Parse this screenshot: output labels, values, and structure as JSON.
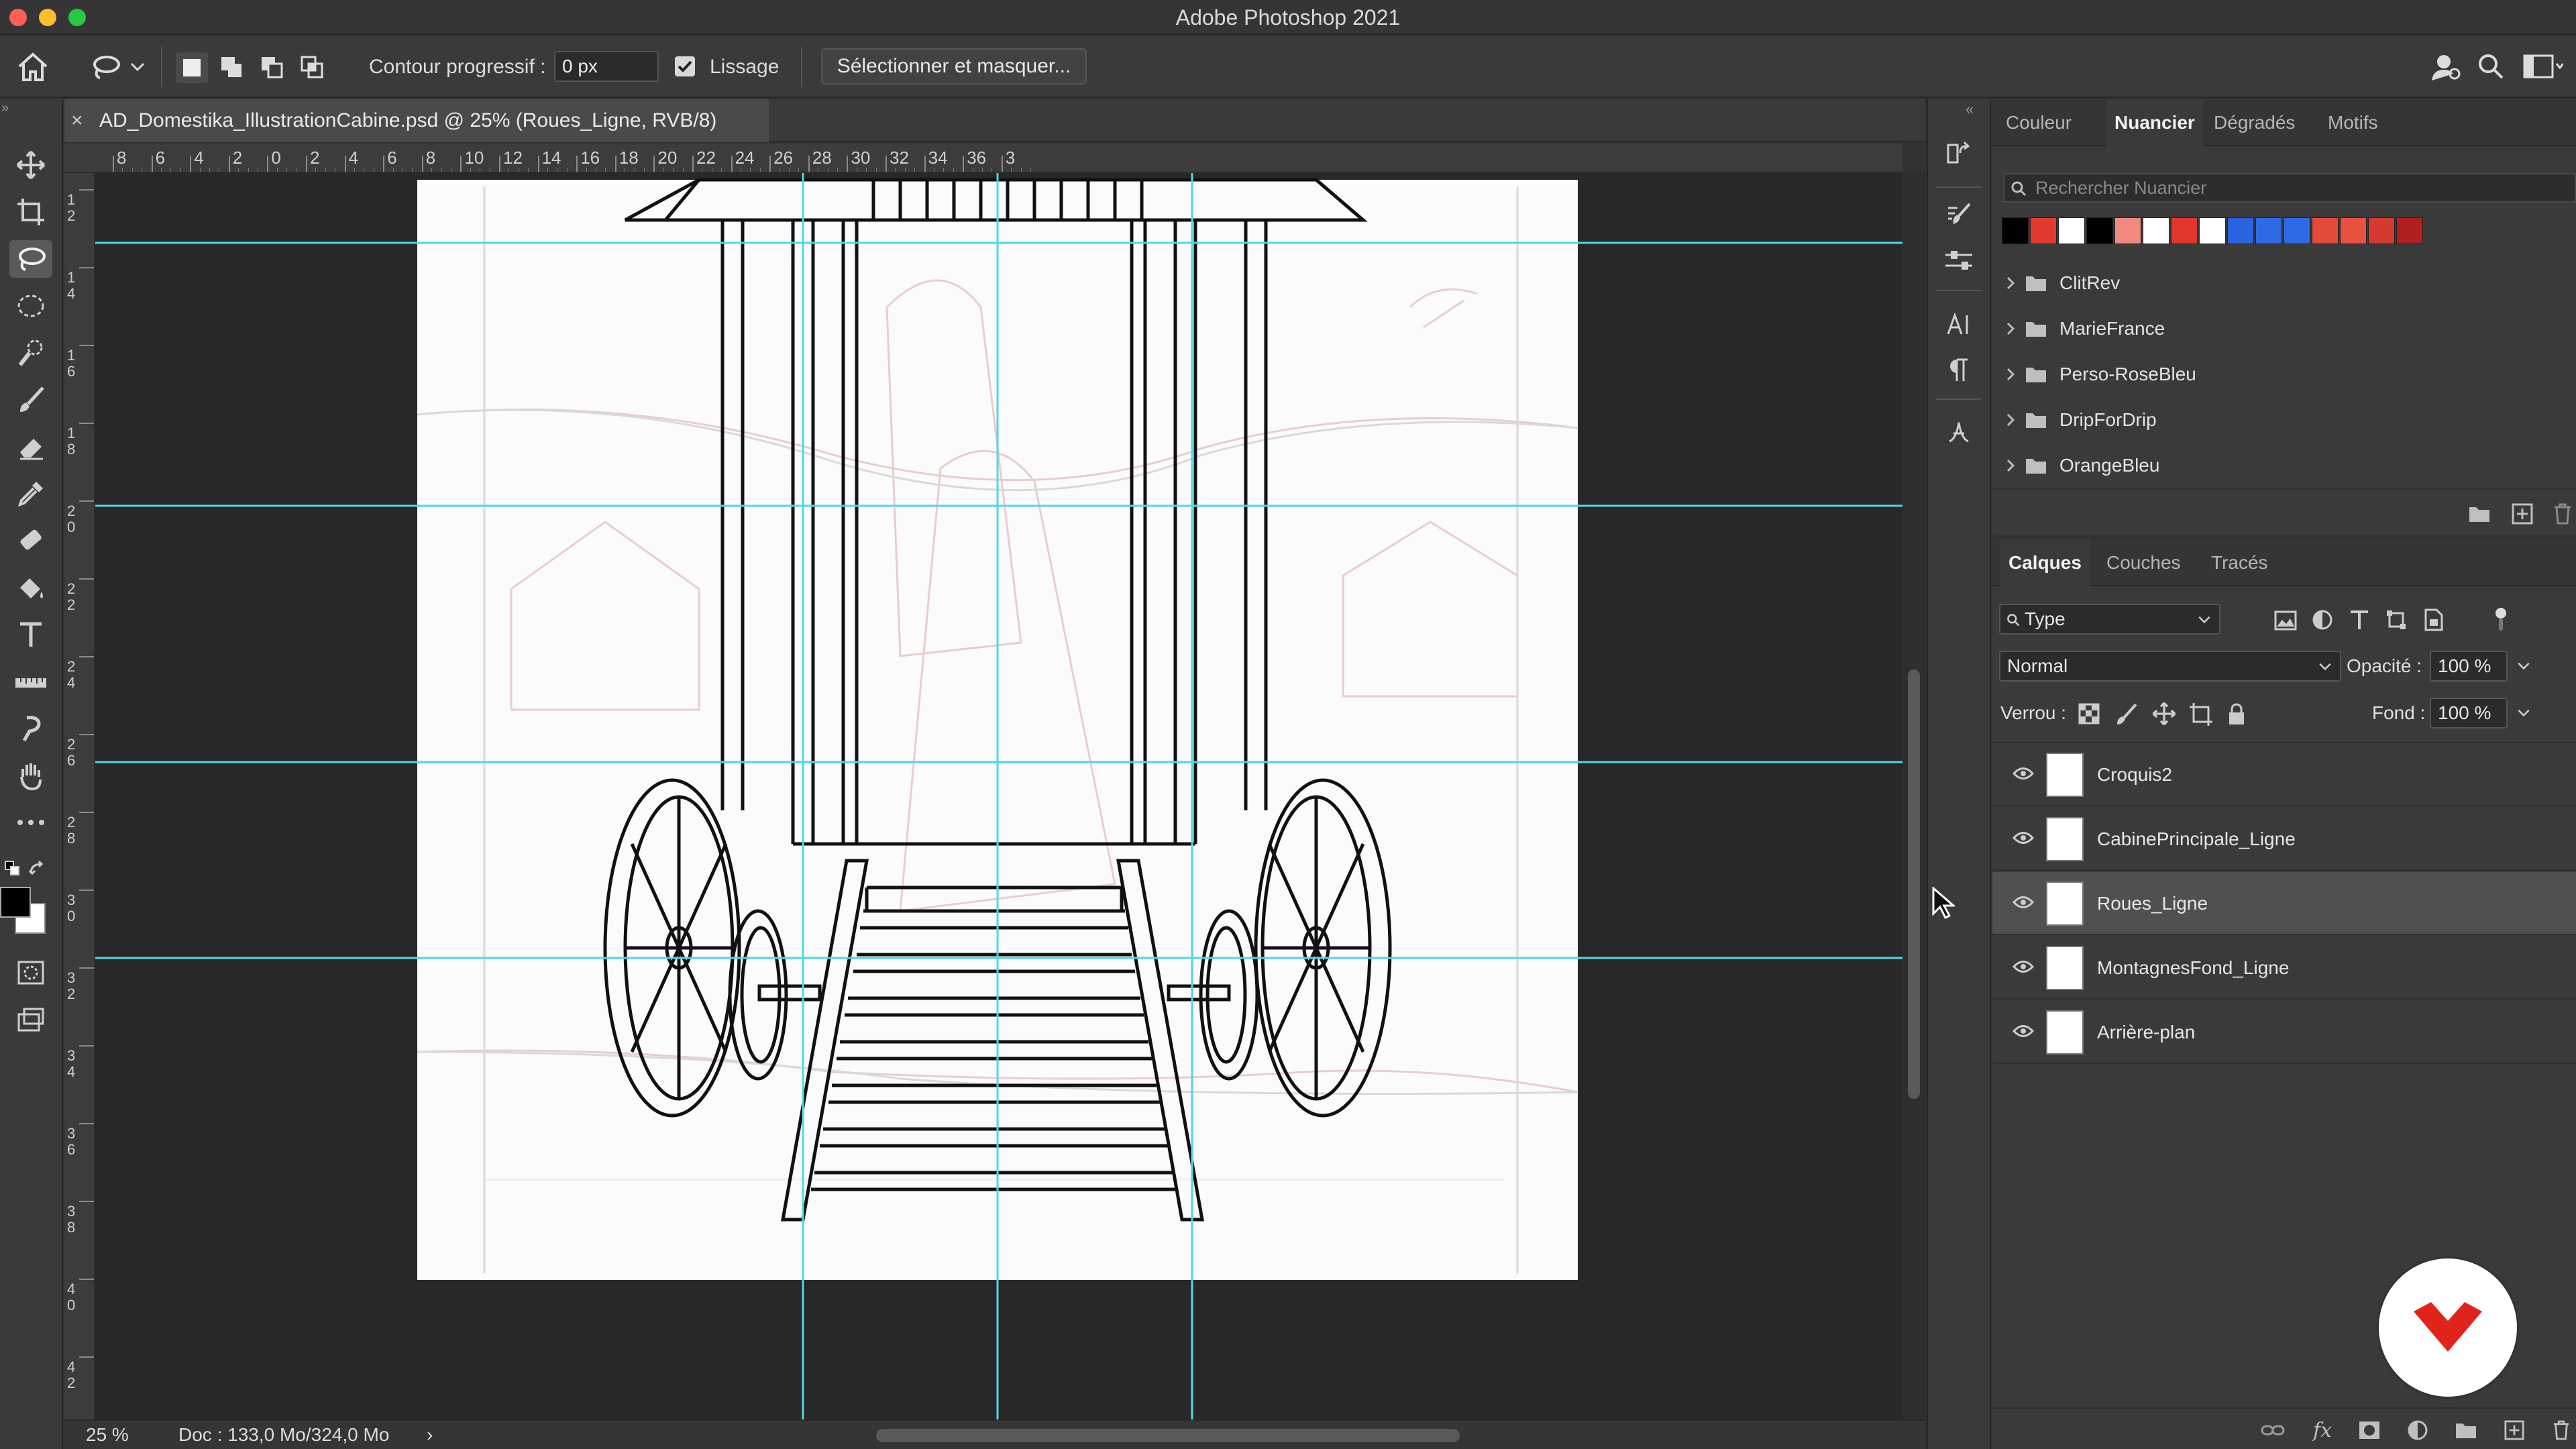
{
  "app_title": "Adobe Photoshop 2021",
  "options": {
    "contour_label": "Contour progressif :",
    "contour_value": "0 px",
    "lissage_label": "Lissage",
    "lissage_checked": true,
    "select_mask_label": "Sélectionner et masquer..."
  },
  "document": {
    "tab_title": "AD_Domestika_IllustrationCabine.psd @ 25% (Roues_Ligne, RVB/8)",
    "close_glyph": "×"
  },
  "ruler": {
    "h_labels": [
      "8",
      "6",
      "4",
      "2",
      "0",
      "2",
      "4",
      "6",
      "8",
      "10",
      "12",
      "14",
      "16",
      "18",
      "20",
      "22",
      "24",
      "26",
      "28",
      "30",
      "32",
      "34",
      "36",
      "3"
    ],
    "v_labels": [
      "1\n2",
      "1\n4",
      "1\n6",
      "1\n8",
      "2\n0",
      "2\n2",
      "2\n4",
      "2\n6",
      "2\n8",
      "3\n0",
      "3\n2",
      "3\n4",
      "3\n6",
      "3\n8",
      "4\n0",
      "4\n2"
    ]
  },
  "status": {
    "zoom": "25 %",
    "doc": "Doc : 133,0 Mo/324,0 Mo",
    "arrow": "›"
  },
  "swatches_panel": {
    "tabs": [
      "Couleur",
      "Nuancier",
      "Dégradés",
      "Motifs"
    ],
    "active_tab": "Nuancier",
    "search_placeholder": "Rechercher Nuancier",
    "swatch_colors": [
      "#000000",
      "#e23b2e",
      "#ffffff",
      "#000000",
      "#f08a80",
      "#ffffff",
      "#e0362c",
      "#ffffff",
      "#2a64e0",
      "#2f6ae6",
      "#2f6ae6",
      "#e24a3a",
      "#e8503f",
      "#d43a2e",
      "#b02020"
    ],
    "folders": [
      "ClitRev",
      "MarieFrance",
      "Perso-RoseBleu",
      "DripForDrip",
      "OrangeBleu"
    ]
  },
  "layers_panel": {
    "tabs": [
      "Calques",
      "Couches",
      "Tracés"
    ],
    "active_tab": "Calques",
    "filter_type": "Type",
    "blend_mode": "Normal",
    "opacity_label": "Opacité :",
    "opacity_value": "100 %",
    "lock_label": "Verrou :",
    "fill_label": "Fond :",
    "fill_value": "100 %",
    "layers": [
      {
        "name": "Croquis2",
        "visible": true,
        "selected": false
      },
      {
        "name": "CabinePrincipale_Ligne",
        "visible": true,
        "selected": false
      },
      {
        "name": "Roues_Ligne",
        "visible": true,
        "selected": true
      },
      {
        "name": "MontagnesFond_Ligne",
        "visible": true,
        "selected": false
      },
      {
        "name": "Arrière-plan",
        "visible": true,
        "selected": false
      }
    ]
  },
  "colors": {
    "accent_guide": "#4fd8e6",
    "brand_badge": "#e0241b",
    "foreground": "#000000",
    "background": "#ffffff"
  }
}
